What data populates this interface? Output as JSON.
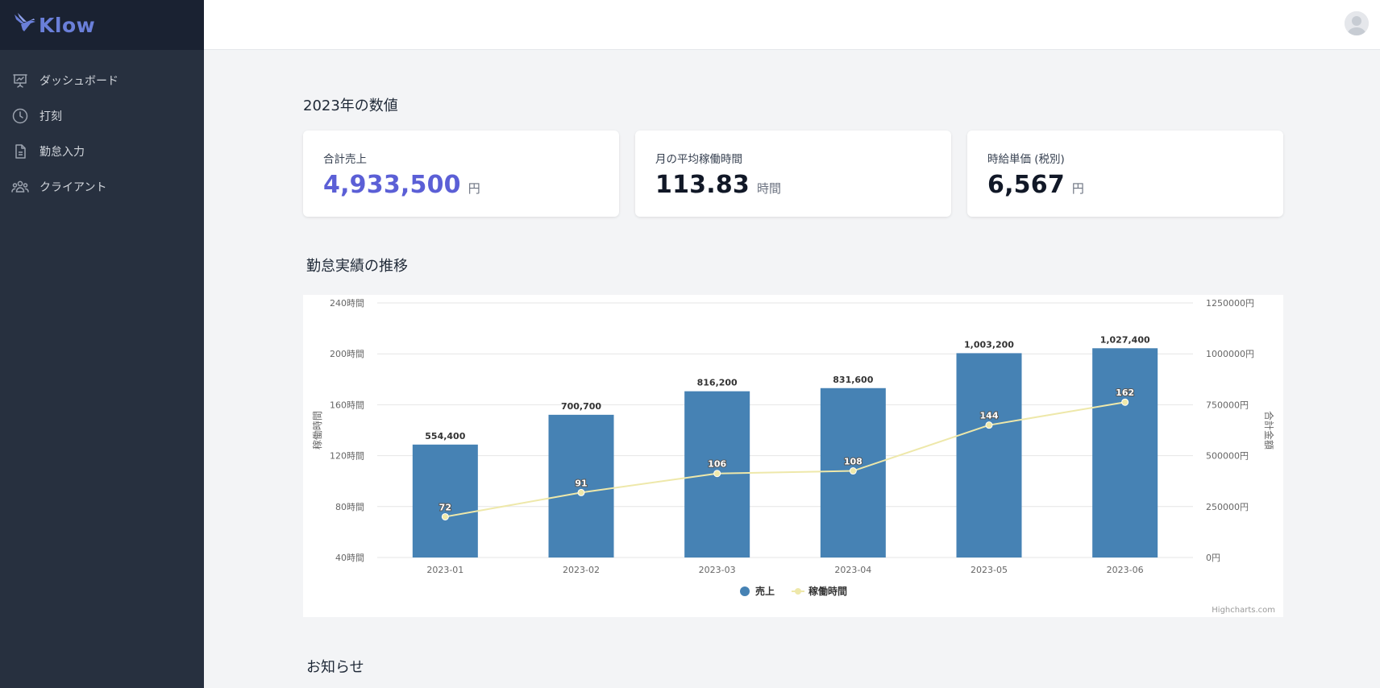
{
  "app": {
    "brand": "Klow"
  },
  "sidebar": {
    "items": [
      {
        "label": "ダッシュボード",
        "icon": "presentation-chart-icon"
      },
      {
        "label": "打刻",
        "icon": "clock-icon"
      },
      {
        "label": "勤怠入力",
        "icon": "document-icon"
      },
      {
        "label": "クライアント",
        "icon": "user-group-icon"
      }
    ]
  },
  "header": {
    "avatar": "user-avatar-icon"
  },
  "main": {
    "stats_title": "2023年の数値",
    "stats": [
      {
        "label": "合計売上",
        "value": "4,933,500",
        "unit": "円"
      },
      {
        "label": "月の平均稼働時間",
        "value": "113.83",
        "unit": "時間"
      },
      {
        "label": "時給単価 (税別)",
        "value": "6,567",
        "unit": "円"
      }
    ],
    "chart_title": "勤怠実績の推移",
    "notice_title": "お知らせ"
  },
  "colors": {
    "sidebar": "#27303f",
    "brand": "#6a7fd9",
    "accent": "#5b5fd6",
    "bar": "#4682b4",
    "line": "#eee8aa"
  },
  "chart_data": {
    "type": "bar",
    "categories": [
      "2023-01",
      "2023-02",
      "2023-03",
      "2023-04",
      "2023-05",
      "2023-06"
    ],
    "series": [
      {
        "name": "売上",
        "type": "bar",
        "axis": "right",
        "values": [
          554400,
          700700,
          816200,
          831600,
          1003200,
          1027400
        ],
        "labels": [
          "554,400",
          "700,700",
          "816,200",
          "831,600",
          "1,003,200",
          "1,027,400"
        ]
      },
      {
        "name": "稼働時間",
        "type": "line",
        "axis": "left",
        "values": [
          72,
          91,
          106,
          108,
          144,
          162
        ]
      }
    ],
    "left_axis": {
      "title": "稼働時間",
      "min": 40,
      "max": 240,
      "ticks": [
        "40時間",
        "80時間",
        "120時間",
        "160時間",
        "200時間",
        "240時間"
      ]
    },
    "right_axis": {
      "title": "合計金額",
      "min": 0,
      "max": 1250000,
      "ticks": [
        "0円",
        "250000円",
        "500000円",
        "750000円",
        "1000000円",
        "1250000円"
      ]
    },
    "credit": "Highcharts.com",
    "grid": true,
    "legend": "bottom-center"
  }
}
